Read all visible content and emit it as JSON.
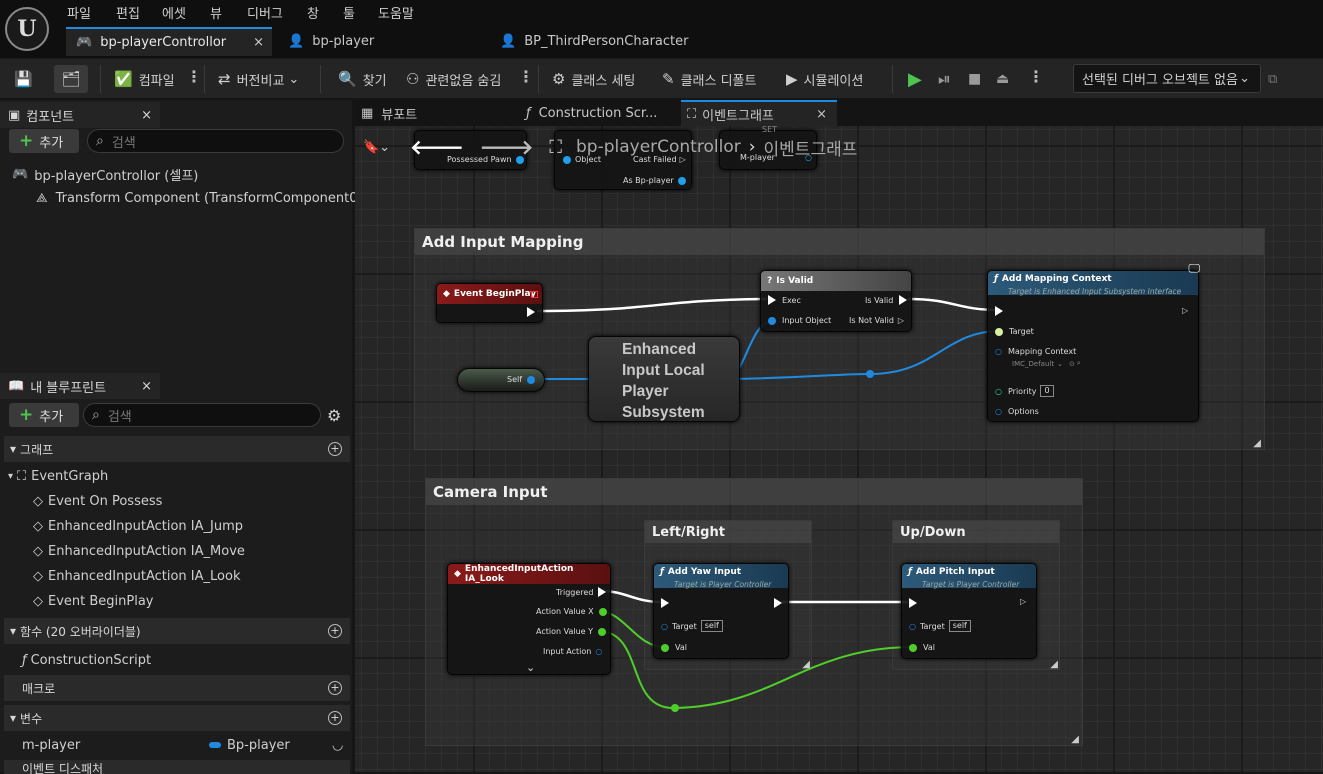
{
  "menu": [
    "파일",
    "편집",
    "에셋",
    "뷰",
    "디버그",
    "창",
    "툴",
    "도움말"
  ],
  "tabs": [
    {
      "label": "bp-playerControllor",
      "close": "×"
    },
    {
      "label": "bp-player"
    },
    {
      "label": "BP_ThirdPersonCharacter"
    }
  ],
  "toolbar": {
    "compile": "컴파일",
    "diff": "버전비교",
    "find": "찾기",
    "hide_unrelated": "관련없음 숨김",
    "class_settings": "클래스 세팅",
    "class_defaults": "클래스 디폴트",
    "simulation": "시뮬레이션",
    "debug_object": "선택된 디버그 오브젝트 없음"
  },
  "components": {
    "title": "컴포넌트",
    "add": "추가",
    "search_placeholder": "검색",
    "root": "bp-playerControllor (셀프)",
    "child": "Transform Component (TransformComponent0)",
    "child_suffix": "C"
  },
  "myblueprint": {
    "title": "내 블루프린트",
    "add": "추가",
    "search_placeholder": "검색",
    "graphs_label": "그래프",
    "event_graph": "EventGraph",
    "events": [
      "Event On Possess",
      "EnhancedInputAction IA_Jump",
      "EnhancedInputAction IA_Move",
      "EnhancedInputAction IA_Look",
      "Event BeginPlay"
    ],
    "functions_label": "함수 (20 오버라이더블)",
    "construction": "ConstructionScript",
    "macros_label": "매크로",
    "variables_label": "변수",
    "var_name": "m-player",
    "var_type": "Bp-player",
    "dispatchers_label": "이벤트 디스패처"
  },
  "graph_tabs": [
    "뷰포트",
    "Construction Scr...",
    "이벤트그래프"
  ],
  "breadcrumb": {
    "bp": "bp-playerControllor",
    "graph": "이벤트그래프"
  },
  "top_nodes": {
    "possessed_pawn": "Possessed Pawn",
    "object": "Object",
    "cast_failed": "Cast Failed",
    "as_bp_player": "As Bp-player",
    "set": "SET",
    "m_player": "M-player"
  },
  "comments": {
    "add_input": "Add Input Mapping",
    "camera": "Camera Input",
    "left_right": "Left/Right",
    "up_down": "Up/Down"
  },
  "nodes": {
    "begin_play": "Event BeginPlay",
    "is_valid": "Is Valid",
    "exec": "Exec",
    "is_valid_out": "Is Valid",
    "input_object": "Input Object",
    "is_not_valid": "Is Not Valid",
    "self": "Self",
    "subsystem": "Enhanced Input Local Player Subsystem",
    "add_mapping": "Add Mapping Context",
    "add_mapping_sub": "Target is Enhanced Input Subsystem Interface",
    "target": "Target",
    "mapping_context": "Mapping Context",
    "imc": "IMC_Default",
    "priority": "Priority",
    "priority_val": "0",
    "options": "Options",
    "ia_look": "EnhancedInputAction IA_Look",
    "triggered": "Triggered",
    "avx": "Action Value X",
    "avy": "Action Value Y",
    "input_action": "Input Action",
    "yaw": "Add Yaw Input",
    "yaw_sub": "Target is Player Controller",
    "pitch": "Add Pitch Input",
    "pitch_sub": "Target is Player Controller",
    "self_val": "self",
    "val": "Val"
  }
}
